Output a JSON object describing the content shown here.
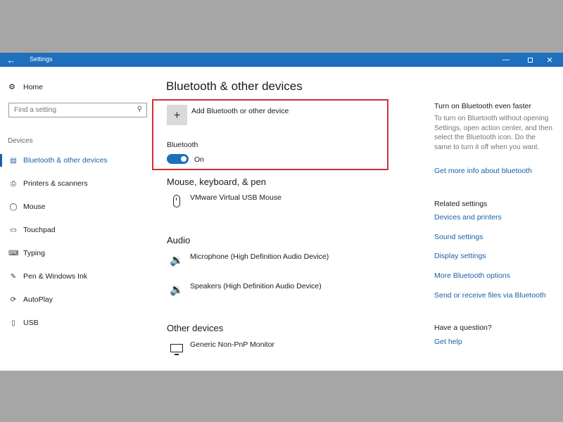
{
  "titlebar": {
    "back_icon": "back-arrow-icon",
    "title": "Settings",
    "minimize": "—",
    "close": "✕"
  },
  "sidebar": {
    "home_label": "Home",
    "search_placeholder": "Find a setting",
    "section_label": "Devices",
    "items": [
      {
        "label": "Bluetooth & other devices",
        "icon": "bluetooth-devices-icon",
        "active": true
      },
      {
        "label": "Printers & scanners",
        "icon": "printer-icon"
      },
      {
        "label": "Mouse",
        "icon": "mouse-icon"
      },
      {
        "label": "Touchpad",
        "icon": "touchpad-icon"
      },
      {
        "label": "Typing",
        "icon": "keyboard-icon"
      },
      {
        "label": "Pen & Windows Ink",
        "icon": "pen-icon"
      },
      {
        "label": "AutoPlay",
        "icon": "autoplay-icon"
      },
      {
        "label": "USB",
        "icon": "usb-icon"
      }
    ]
  },
  "main": {
    "title": "Bluetooth & other devices",
    "add_device_label": "Add Bluetooth or other device",
    "bluetooth_label": "Bluetooth",
    "bluetooth_state": "On",
    "sections": {
      "mouse_keyboard_pen": {
        "heading": "Mouse, keyboard, & pen",
        "devices": [
          "VMware Virtual USB Mouse"
        ]
      },
      "audio": {
        "heading": "Audio",
        "devices": [
          "Microphone (High Definition Audio Device)",
          "Speakers (High Definition Audio Device)"
        ]
      },
      "other_devices": {
        "heading": "Other devices",
        "devices": [
          "Generic Non-PnP Monitor"
        ]
      }
    }
  },
  "right": {
    "tip_heading": "Turn on Bluetooth even faster",
    "tip_text": "To turn on Bluetooth without opening Settings, open action center, and then select the Bluetooth icon. Do the same to turn it off when you want.",
    "tip_link": "Get more info about bluetooth",
    "related_heading": "Related settings",
    "related_links": [
      "Devices and printers",
      "Sound settings",
      "Display settings",
      "More Bluetooth options",
      "Send or receive files via Bluetooth"
    ],
    "question_heading": "Have a question?",
    "help_link": "Get help"
  },
  "colors": {
    "titlebar": "#1e6fbd",
    "accent": "#1a5fa8",
    "highlight_box": "#d32f2f"
  }
}
